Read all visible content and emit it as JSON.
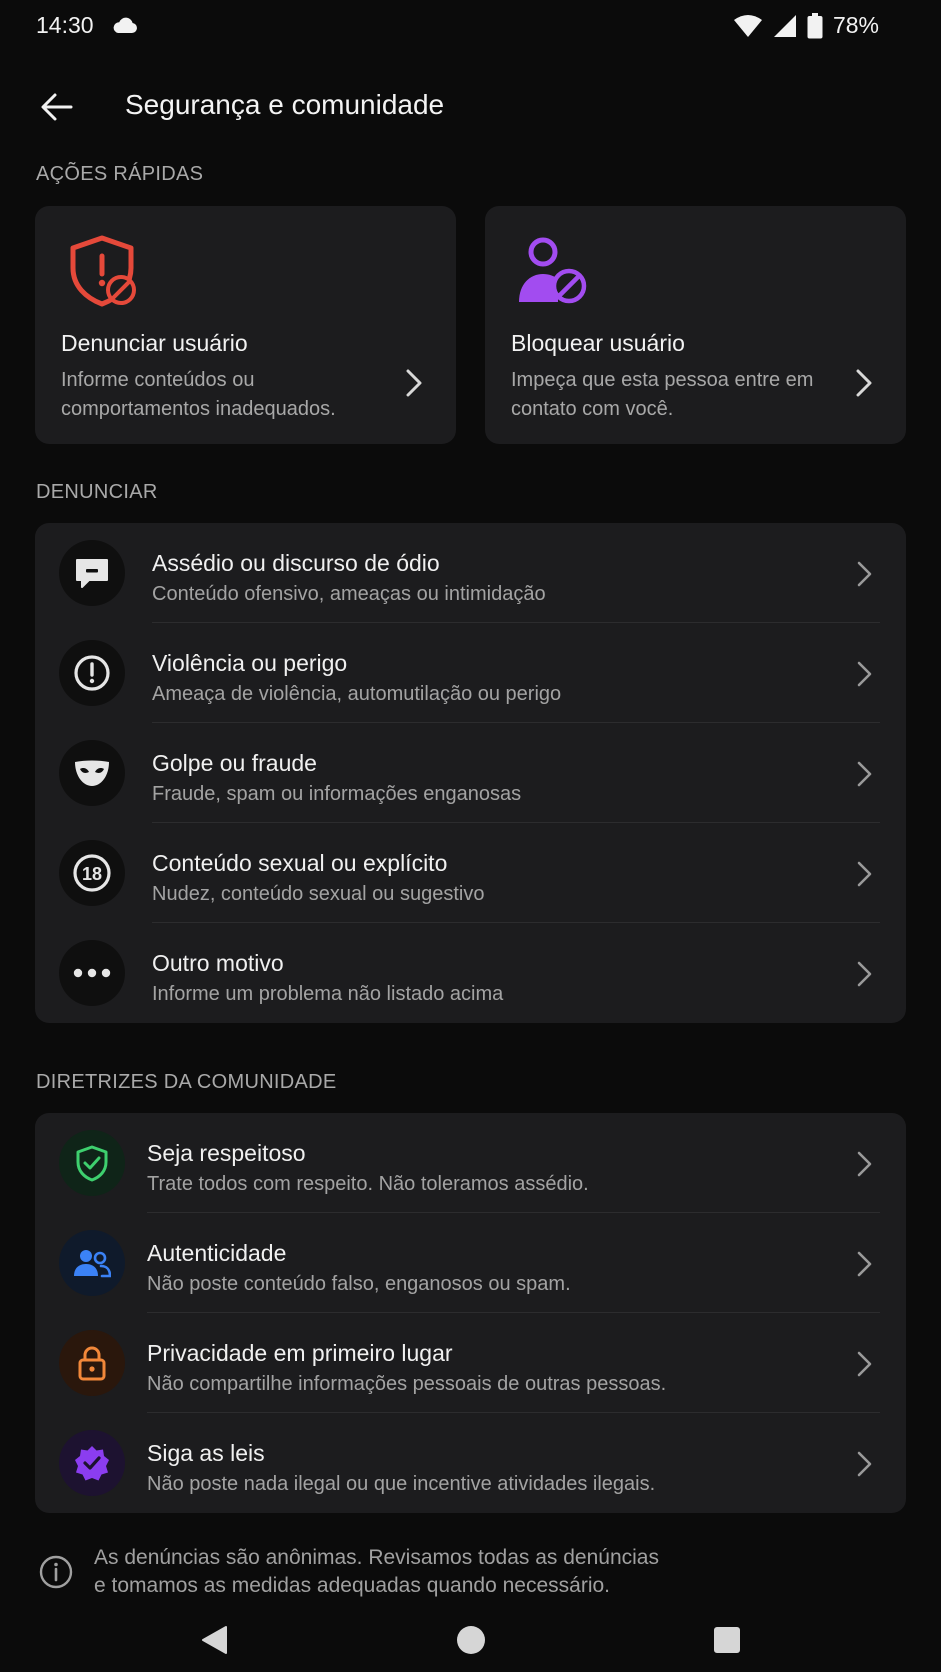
{
  "status_bar": {
    "time": "14:30",
    "battery_percent": "78%",
    "icons": [
      "cloud-icon",
      "wifi-icon",
      "signal-icon",
      "battery-icon"
    ]
  },
  "app_bar": {
    "title": "Segurança e comunidade",
    "back_icon": "arrow-left-icon"
  },
  "quick_actions": {
    "label": "AÇÕES RÁPIDAS",
    "items": [
      {
        "title": "Denunciar usuário",
        "description": "Informe conteúdos ou comportamentos inadequados.",
        "icon": "shield-alert-icon",
        "color": "#e5493a"
      },
      {
        "title": "Bloquear usuário",
        "description": "Impeça que esta pessoa entre em contato com você.",
        "icon": "user-block-icon",
        "color": "#a24cf0"
      }
    ]
  },
  "report": {
    "label": "DENUNCIAR",
    "items": [
      {
        "title": "Assédio ou discurso de ódio",
        "subtitle": "Conteúdo ofensivo, ameaças ou intimidação",
        "icon": "speech-bubble-icon"
      },
      {
        "title": "Violência ou perigo",
        "subtitle": "Ameaça de violência, automutilação ou perigo",
        "icon": "alert-circle-icon"
      },
      {
        "title": "Golpe ou fraude",
        "subtitle": "Fraude, spam ou informações enganosas",
        "icon": "mask-icon"
      },
      {
        "title": "Conteúdo sexual ou explícito",
        "subtitle": "Nudez, conteúdo sexual ou sugestivo",
        "icon": "eighteen-plus-icon",
        "icon_text": "18"
      },
      {
        "title": "Outro motivo",
        "subtitle": "Informe um problema não listado acima",
        "icon": "more-dots-icon"
      }
    ]
  },
  "guidelines": {
    "label": "DIRETRIZES DA COMUNIDADE",
    "items": [
      {
        "title": "Seja respeitoso",
        "subtitle": "Trate todos com respeito. Não toleramos assédio.",
        "icon": "shield-check-icon",
        "color": "#3ecf6e"
      },
      {
        "title": "Autenticidade",
        "subtitle": "Não poste conteúdo falso, enganosos ou spam.",
        "icon": "users-icon",
        "color": "#3b82f6"
      },
      {
        "title": "Privacidade em primeiro lugar",
        "subtitle": "Não compartilhe informações pessoais de outras pessoas.",
        "icon": "lock-icon",
        "color": "#f2883a"
      },
      {
        "title": "Siga as leis",
        "subtitle": "Não poste nada ilegal ou que incentive atividades ilegais.",
        "icon": "verified-badge-icon",
        "color": "#8b3df0"
      }
    ]
  },
  "footer": {
    "note_line1": "As denúncias são anônimas. Revisamos todas as denúncias",
    "note_line2": "e tomamos as medidas adequadas quando necessário.",
    "icon": "info-icon"
  },
  "nav_bar": {
    "buttons": [
      "back-triangle-icon",
      "home-circle-icon",
      "recents-square-icon"
    ]
  }
}
